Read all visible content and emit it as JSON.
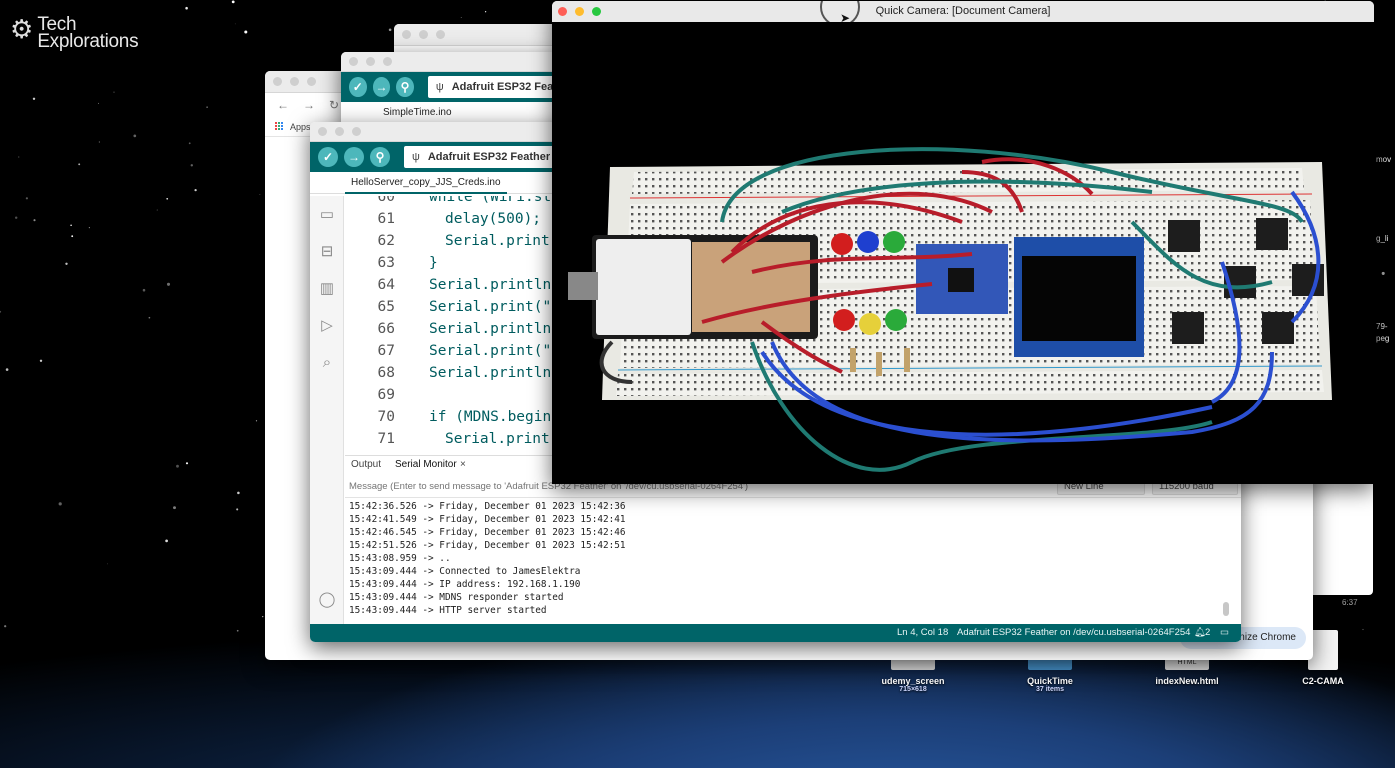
{
  "desktop": {
    "logo_line1": "Tech",
    "logo_line2": "Explorations",
    "edge_labels": [
      "mov",
      "g_li",
      "79-",
      "peg",
      "6:37"
    ],
    "icons": [
      {
        "name": "udemy_screen",
        "sub": "715×618"
      },
      {
        "name": "QuickTime",
        "sub": "37 items"
      },
      {
        "name": "indexNew.html",
        "sub": "",
        "thumb": "HTML"
      },
      {
        "name": "C2-CAMA",
        "sub": ""
      }
    ],
    "right_window_text": "at",
    "minimize_chrome": "nize Chrome"
  },
  "chrome": {
    "apps_label": "Apps"
  },
  "arduino_back": {
    "board": "Adafruit ESP32 Fea",
    "tab": "SimpleTime.ino"
  },
  "arduino": {
    "board": "Adafruit ESP32 Feather",
    "tab": "HelloServer_copy_JJS_Creds.ino",
    "code": [
      {
        "ln": "60",
        "text": "while (WiFi.st",
        "indent": false
      },
      {
        "ln": "61",
        "text": "delay(500);",
        "indent": true
      },
      {
        "ln": "62",
        "text": "Serial.print",
        "indent": true
      },
      {
        "ln": "63",
        "text": "}",
        "indent": false
      },
      {
        "ln": "64",
        "text": "Serial.println",
        "indent": false
      },
      {
        "ln": "65",
        "text": "Serial.print(\"",
        "indent": false
      },
      {
        "ln": "66",
        "text": "Serial.println",
        "indent": false
      },
      {
        "ln": "67",
        "text": "Serial.print(\"",
        "indent": false
      },
      {
        "ln": "68",
        "text": "Serial.println",
        "indent": false
      },
      {
        "ln": "69",
        "text": "",
        "indent": false
      },
      {
        "ln": "70",
        "text": "if (MDNS.begin",
        "indent": false
      },
      {
        "ln": "71",
        "text": "Serial.print",
        "indent": true
      }
    ],
    "panel_tabs": {
      "output": "Output",
      "serial": "Serial Monitor",
      "close": "×"
    },
    "message_placeholder": "Message (Enter to send message to 'Adafruit ESP32 Feather' on '/dev/cu.usbserial-0264F254')",
    "line_ending": "New Line",
    "baud": "115200 baud",
    "serial_lines": [
      "15:42:36.526 -> Friday, December 01 2023 15:42:36",
      "15:42:41.549 -> Friday, December 01 2023 15:42:41",
      "15:42:46.545 -> Friday, December 01 2023 15:42:46",
      "15:42:51.526 -> Friday, December 01 2023 15:42:51",
      "15:43:08.959 -> ..",
      "15:43:09.444 -> Connected to JamesElektra",
      "15:43:09.444 -> IP address: 192.168.1.190",
      "15:43:09.444 -> MDNS responder started",
      "15:43:09.444 -> HTTP server started"
    ],
    "status": {
      "position": "Ln 4, Col 18",
      "board_port": "Adafruit ESP32 Feather on /dev/cu.usbserial-0264F254",
      "notifications": "2"
    }
  },
  "camera": {
    "title": "Quick Camera: [Document Camera]"
  }
}
